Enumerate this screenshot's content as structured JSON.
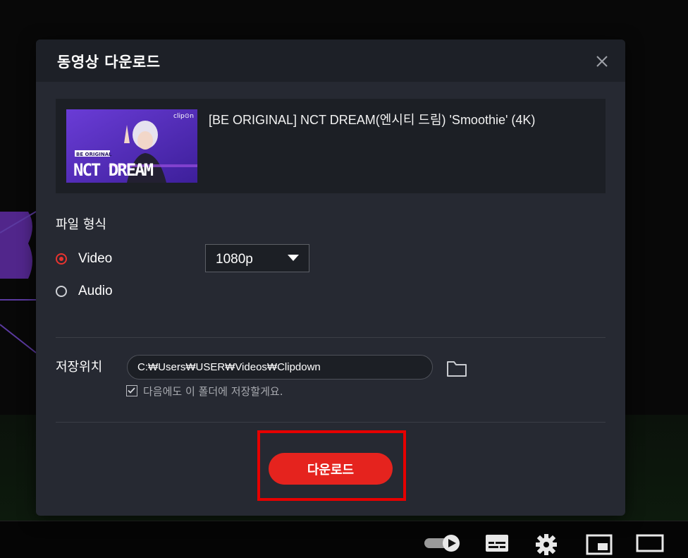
{
  "dialog": {
    "title": "동영상 다운로드",
    "close_icon": "close-icon"
  },
  "video": {
    "title": "[BE ORIGINAL] NCT DREAM(엔시티 드림) 'Smoothie' (4K)",
    "thumbnail_text": {
      "brand": "clip⊙n",
      "small": "BE ORIGINAL",
      "big": "NCT DREAM"
    }
  },
  "format": {
    "label": "파일 형식",
    "options": [
      {
        "label": "Video",
        "selected": true
      },
      {
        "label": "Audio",
        "selected": false
      }
    ],
    "quality": "1080p"
  },
  "save": {
    "label": "저장위치",
    "path": "C:₩Users₩USER₩Videos₩Clipdown",
    "remember_label": "다음에도 이 폴더에 저장할게요.",
    "remember_checked": true
  },
  "actions": {
    "download_label": "다운로드"
  },
  "colors": {
    "accent": "#e5231e",
    "dialog_bg": "#262932",
    "header_bg": "#1d2027",
    "highlight": "#e60000"
  },
  "player_controls": [
    "autoplay-toggle-icon",
    "subtitles-icon",
    "settings-gear-icon",
    "miniplayer-icon",
    "theater-mode-icon"
  ]
}
